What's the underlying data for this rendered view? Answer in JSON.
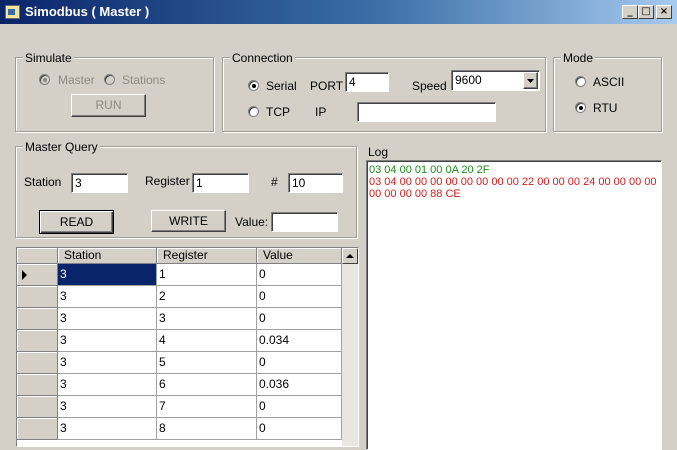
{
  "window": {
    "title": "Simodbus ( Master )",
    "controls": {
      "minimize": "_",
      "maximize": "□",
      "close": "×"
    }
  },
  "simulate": {
    "legend": "Simulate",
    "master_label": "Master",
    "stations_label": "Stations",
    "selected": "Master",
    "run_label": "RUN"
  },
  "connection": {
    "legend": "Connection",
    "serial_label": "Serial",
    "tcp_label": "TCP",
    "selected": "Serial",
    "port_label": "PORT",
    "port_value": "4",
    "speed_label": "Speed",
    "speed_value": "9600",
    "ip_label": "IP",
    "ip_value": ""
  },
  "mode": {
    "legend": "Mode",
    "ascii_label": "ASCII",
    "rtu_label": "RTU",
    "selected": "RTU"
  },
  "master_query": {
    "legend": "Master Query",
    "station_label": "Station",
    "station_value": "3",
    "register_label": "Register",
    "register_value": "1",
    "count_label": "#",
    "count_value": "10",
    "read_label": "READ",
    "write_label": "WRITE",
    "value_label": "Value:",
    "value_value": ""
  },
  "log": {
    "label": "Log",
    "lines": [
      {
        "text": "03 04 00 01 00 0A 20 2F",
        "color": "#1e8c1e"
      },
      {
        "text": "03 04 00 00 00 00 00 00 00 00 22 00 00 00 24 00 00 00 00 00 00 00 00 88 CE",
        "color": "#d21e1e"
      }
    ]
  },
  "grid": {
    "columns": [
      "Station",
      "Register",
      "Value"
    ],
    "selected_row": 0,
    "rows": [
      [
        "3",
        "1",
        "0"
      ],
      [
        "3",
        "2",
        "0"
      ],
      [
        "3",
        "3",
        "0"
      ],
      [
        "3",
        "4",
        "0.034"
      ],
      [
        "3",
        "5",
        "0"
      ],
      [
        "3",
        "6",
        "0.036"
      ],
      [
        "3",
        "7",
        "0"
      ],
      [
        "3",
        "8",
        "0"
      ]
    ]
  },
  "icons": {
    "row_pointer": "triangle-right-icon",
    "dropdown": "chevron-down-icon",
    "scroll_up": "triangle-up-icon"
  },
  "colors": {
    "titlebar_start": "#0a246a",
    "titlebar_end": "#a6caf0",
    "selection": "#0a246a",
    "log_sent": "#1e8c1e",
    "log_received": "#d21e1e"
  }
}
